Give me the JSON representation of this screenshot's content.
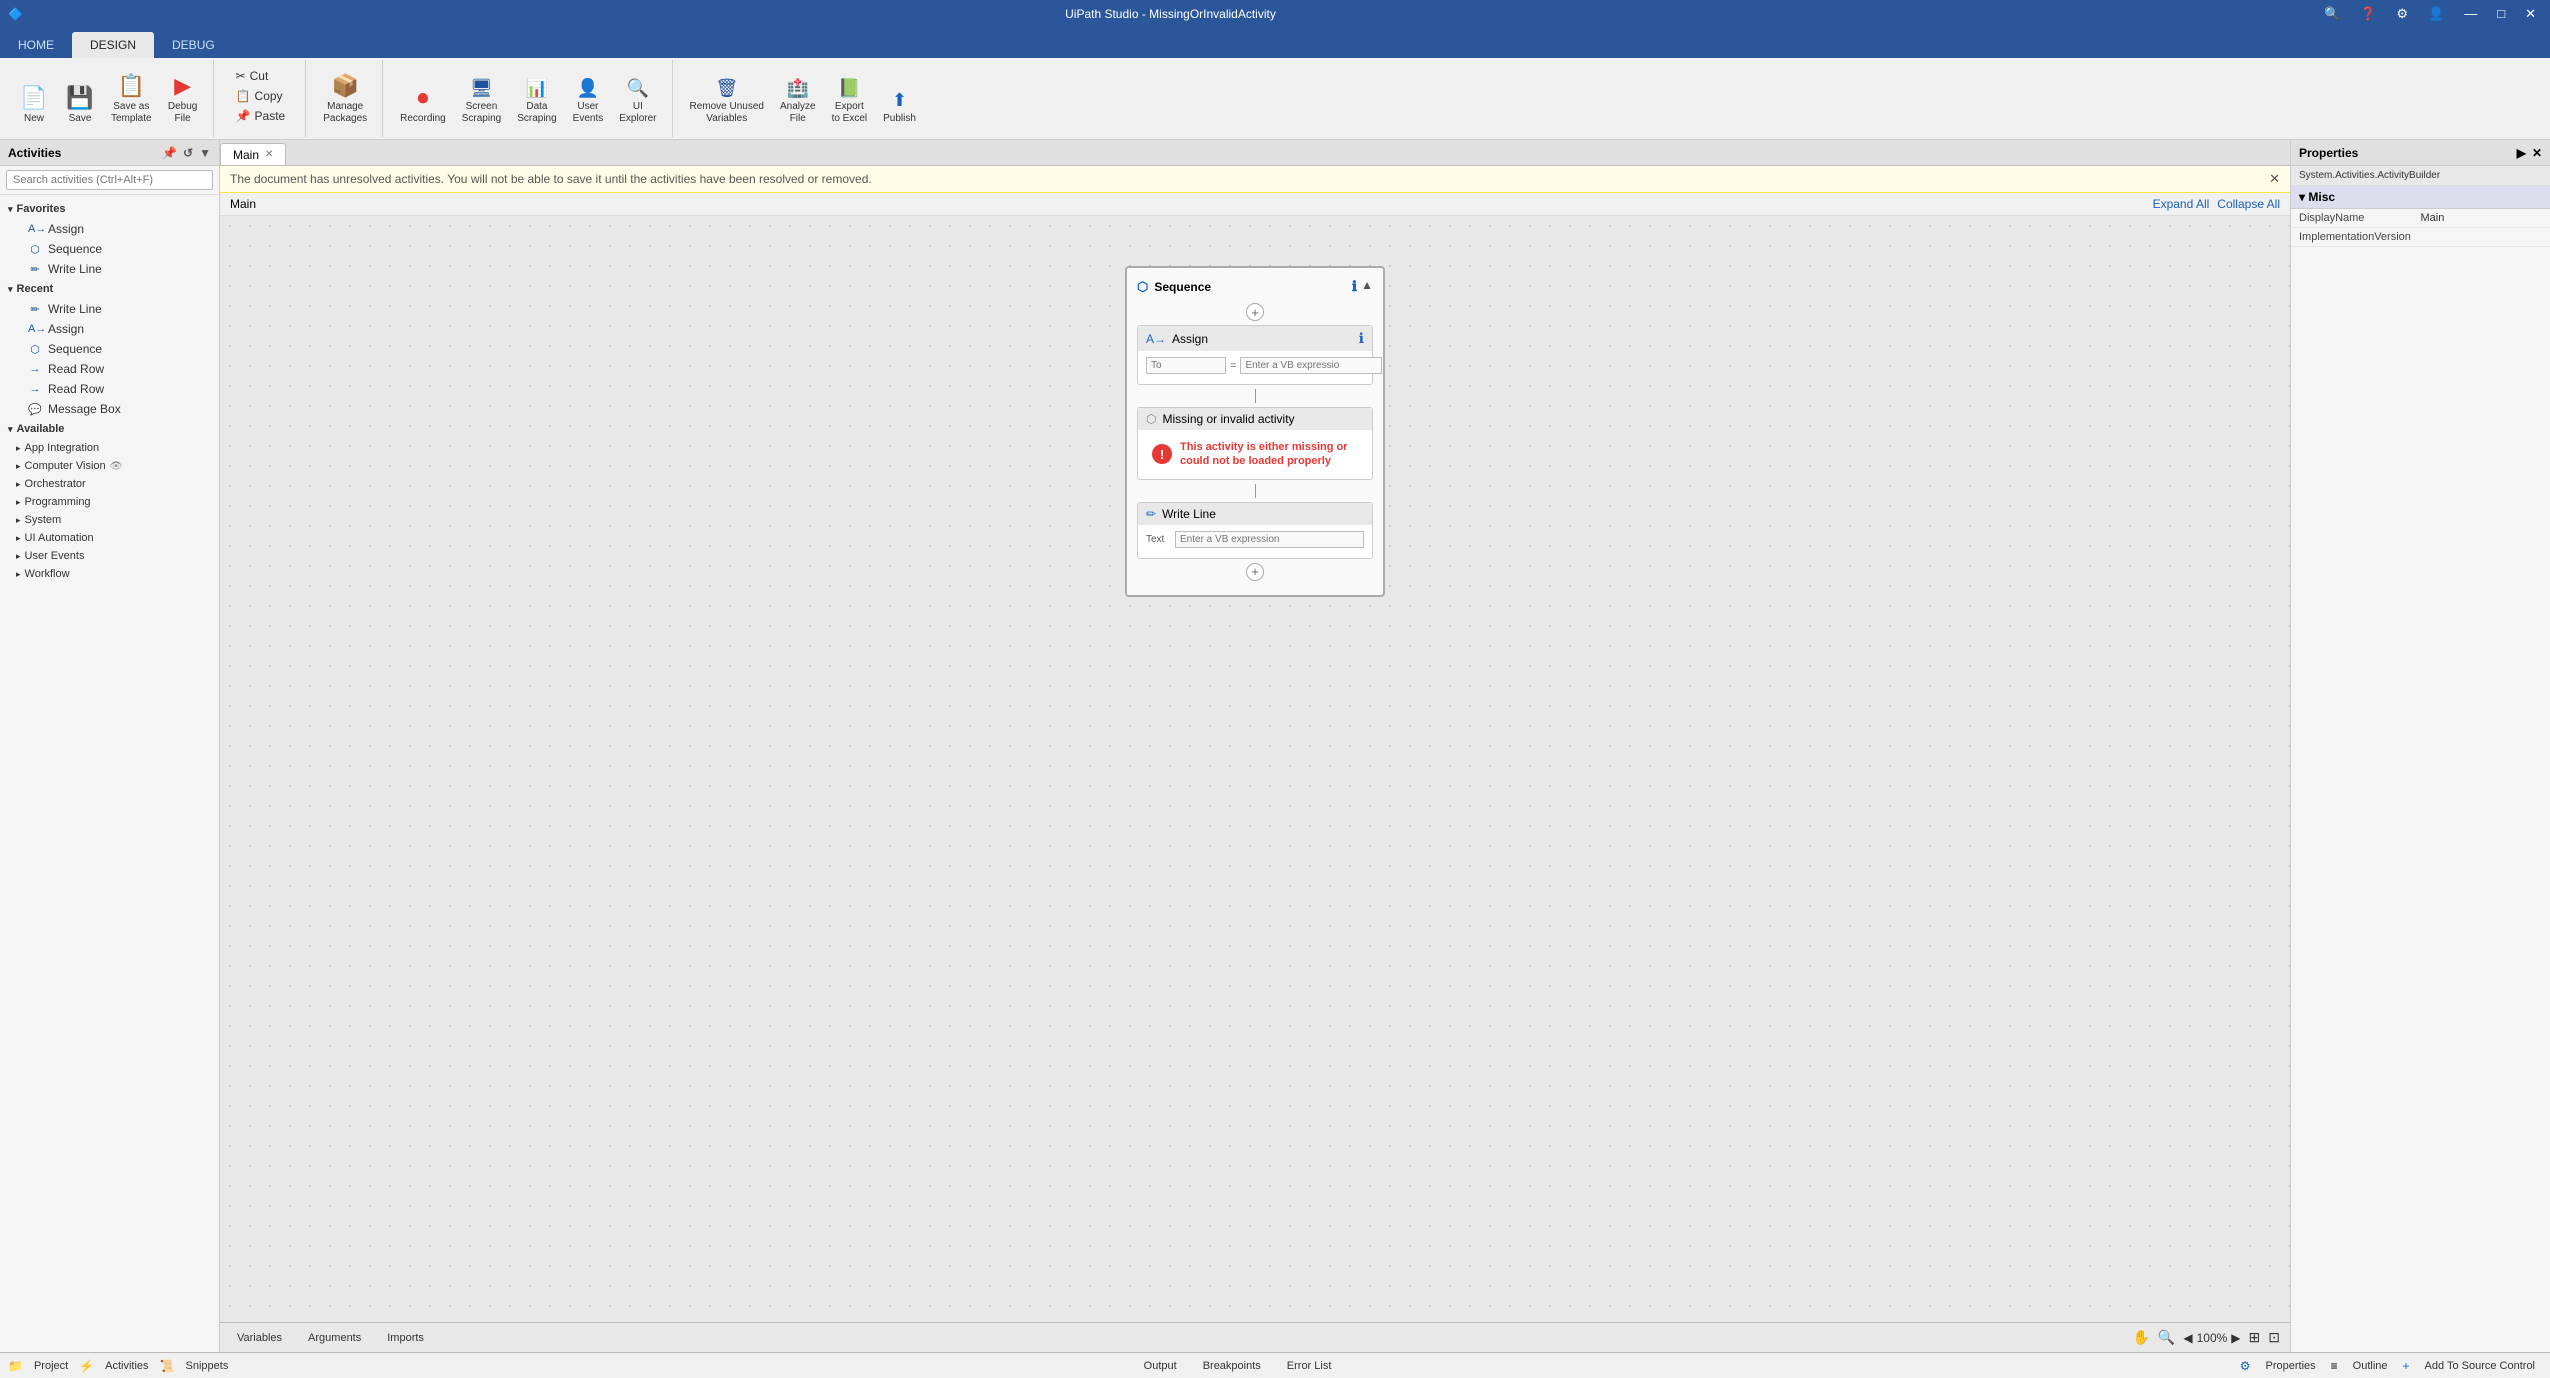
{
  "window": {
    "title": "UiPath Studio - MissingOrInvalidActivity",
    "tabs": [
      "HOME",
      "DESIGN",
      "DEBUG"
    ],
    "active_tab": "DESIGN"
  },
  "ribbon": {
    "groups": [
      {
        "name": "file-group",
        "buttons": [
          {
            "id": "new",
            "label": "New",
            "icon": "📄"
          },
          {
            "id": "save",
            "label": "Save",
            "icon": "💾"
          },
          {
            "id": "save-template",
            "label": "Save as\nTemplate",
            "icon": "📋"
          },
          {
            "id": "debug",
            "label": "Debug\nFile",
            "icon": "▶"
          }
        ]
      },
      {
        "name": "clipboard-group",
        "buttons": [
          {
            "id": "cut-copy-paste",
            "label": "Cut Copy\nPaste",
            "icon": "✂️"
          }
        ]
      },
      {
        "name": "manage-group",
        "buttons": [
          {
            "id": "manage-packages",
            "label": "Manage\nPackages",
            "icon": "📦"
          }
        ]
      },
      {
        "name": "recording-group",
        "buttons": [
          {
            "id": "recording",
            "label": "Recording",
            "icon": "⏺"
          },
          {
            "id": "screen-scraping",
            "label": "Screen\nScraping",
            "icon": "🖥"
          },
          {
            "id": "data-scraping",
            "label": "Data\nScraping",
            "icon": "📊"
          },
          {
            "id": "user-events",
            "label": "User\nEvents",
            "icon": "👤"
          },
          {
            "id": "ui-explorer",
            "label": "UI\nExplorer",
            "icon": "🔍"
          }
        ]
      },
      {
        "name": "tools-group",
        "buttons": [
          {
            "id": "remove-unused-variables",
            "label": "Remove Unused\nVariables",
            "icon": "🗑"
          },
          {
            "id": "analyze-file",
            "label": "Analyze\nFile",
            "icon": "🏥"
          },
          {
            "id": "export-to-excel",
            "label": "Export\nto Excel",
            "icon": "📗"
          },
          {
            "id": "publish",
            "label": "Publish",
            "icon": "🚀"
          }
        ]
      }
    ]
  },
  "activities_panel": {
    "title": "Activities",
    "search_placeholder": "Search activities (Ctrl+Alt+F)",
    "favorites": {
      "label": "Favorites",
      "items": [
        {
          "label": "Assign",
          "icon": "A"
        },
        {
          "label": "Sequence",
          "icon": "S"
        },
        {
          "label": "Write Line",
          "icon": "W"
        }
      ]
    },
    "recent": {
      "label": "Recent",
      "items": [
        {
          "label": "Write Line",
          "icon": "W"
        },
        {
          "label": "Assign",
          "icon": "A"
        },
        {
          "label": "Sequence",
          "icon": "S"
        },
        {
          "label": "Read Row",
          "icon": "R"
        },
        {
          "label": "Read Row",
          "icon": "R"
        },
        {
          "label": "Message Box",
          "icon": "M"
        }
      ]
    },
    "available": {
      "label": "Available",
      "sections": [
        {
          "label": "App Integration"
        },
        {
          "label": "Computer Vision"
        },
        {
          "label": "Orchestrator"
        },
        {
          "label": "Programming"
        },
        {
          "label": "System"
        },
        {
          "label": "UI Automation"
        },
        {
          "label": "User Events"
        },
        {
          "label": "Workflow"
        }
      ]
    }
  },
  "canvas": {
    "tab_label": "Main",
    "warning": "The document has unresolved activities. You will not be able to save it until the activities have been resolved or removed.",
    "breadcrumb": "Main",
    "expand_all": "Expand All",
    "collapse_all": "Collapse All",
    "sequence": {
      "label": "Sequence",
      "assign": {
        "label": "Assign",
        "to_placeholder": "To",
        "value_placeholder": "Enter a VB expressio"
      },
      "missing": {
        "label": "Missing or invalid activity",
        "error_text": "This activity is either missing or could not be loaded properly"
      },
      "write_line": {
        "label": "Write Line",
        "text_label": "Text",
        "text_placeholder": "Enter a VB expression"
      }
    }
  },
  "properties_panel": {
    "title": "Properties",
    "collapse_icon": "◀",
    "activity_type": "System.Activities.ActivityBuilder",
    "sections": [
      {
        "label": "Misc",
        "properties": [
          {
            "key": "DisplayName",
            "value": "Main"
          },
          {
            "key": "ImplementationVersion",
            "value": ""
          }
        ]
      }
    ]
  },
  "footer_tabs": {
    "canvas_tabs": [
      {
        "label": "Variables"
      },
      {
        "label": "Arguments"
      },
      {
        "label": "Imports"
      }
    ],
    "bottom_tabs": [
      {
        "label": "Output"
      },
      {
        "label": "Breakpoints"
      },
      {
        "label": "Error List"
      }
    ],
    "zoom": "100%"
  },
  "status_bar": {
    "add_to_source": "Add To Source Control",
    "properties_tab": "Properties",
    "outline_tab": "Outline"
  }
}
